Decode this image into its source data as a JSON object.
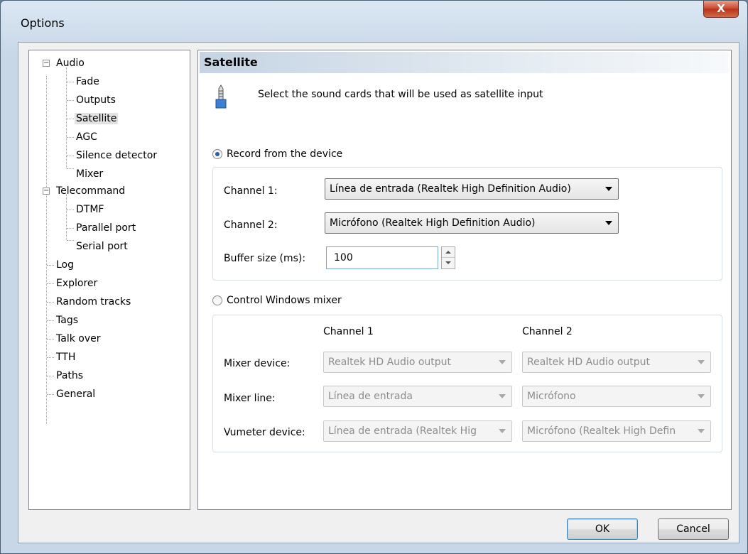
{
  "window": {
    "title": "Options",
    "close_glyph": "X"
  },
  "tree": {
    "items": [
      {
        "label": "Audio",
        "expander": "−"
      },
      {
        "label": "Fade"
      },
      {
        "label": "Outputs"
      },
      {
        "label": "Satellite"
      },
      {
        "label": "AGC"
      },
      {
        "label": "Silence detector"
      },
      {
        "label": "Mixer"
      },
      {
        "label": "Telecommand",
        "expander": "−"
      },
      {
        "label": "DTMF"
      },
      {
        "label": "Parallel port"
      },
      {
        "label": "Serial port"
      },
      {
        "label": "Log"
      },
      {
        "label": "Explorer"
      },
      {
        "label": "Random tracks"
      },
      {
        "label": "Tags"
      },
      {
        "label": "Talk over"
      },
      {
        "label": "TTH"
      },
      {
        "label": "Paths"
      },
      {
        "label": "General"
      }
    ],
    "selected": "Satellite"
  },
  "pane": {
    "title": "Satellite",
    "description": "Select the sound cards that will be used as satellite input",
    "record": {
      "label": "Record from the device",
      "channel1_label": "Channel 1:",
      "channel1_value": "Línea de entrada (Realtek High Definition Audio)",
      "channel2_label": "Channel 2:",
      "channel2_value": "Micrófono (Realtek High Definition Audio)",
      "buffer_label": "Buffer size (ms):",
      "buffer_value": "100"
    },
    "mixer": {
      "label": "Control Windows mixer",
      "col1": "Channel 1",
      "col2": "Channel 2",
      "device_label": "Mixer device:",
      "device1": "Realtek HD Audio output",
      "device2": "Realtek HD Audio output",
      "line_label": "Mixer line:",
      "line1": "Línea de entrada",
      "line2": "Micrófono",
      "vumeter_label": "Vumeter device:",
      "vumeter1": "Línea de entrada (Realtek Hig",
      "vumeter2": "Micrófono (Realtek High Defin"
    }
  },
  "buttons": {
    "ok": "OK",
    "cancel": "Cancel"
  }
}
